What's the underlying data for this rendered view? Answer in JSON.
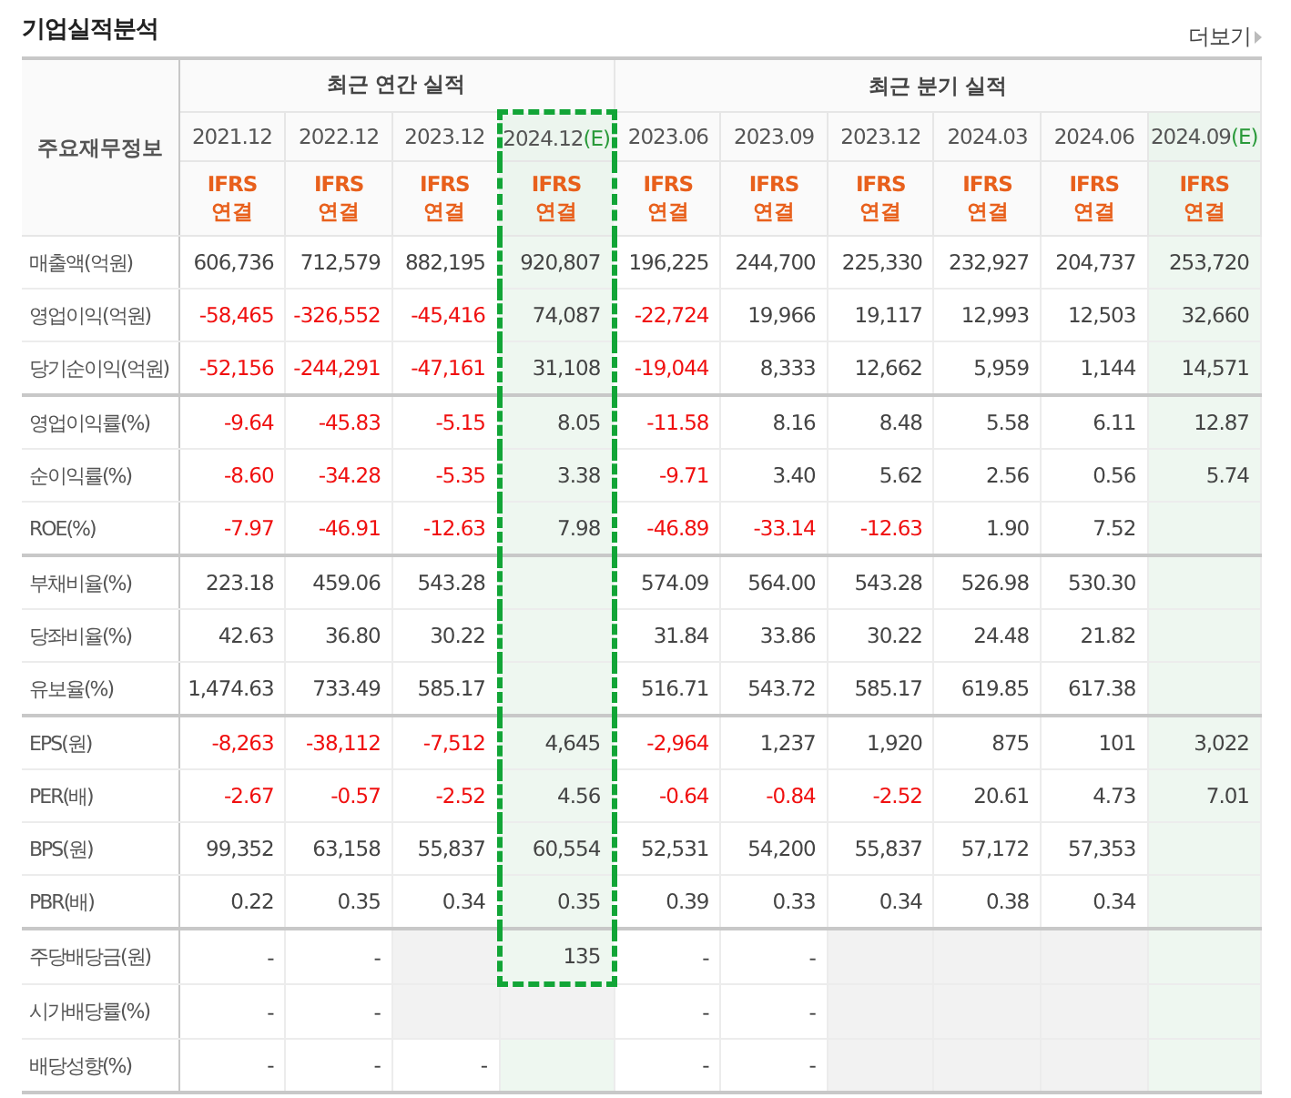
{
  "title": "기업실적분석",
  "more_link": "더보기",
  "table": {
    "corner": "주요재무정보",
    "groups": [
      {
        "label": "최근 연간 실적",
        "columns": [
          {
            "date": "2021.12",
            "basis": "IFRS",
            "scope": "연결",
            "estimate": false,
            "boxed": false
          },
          {
            "date": "2022.12",
            "basis": "IFRS",
            "scope": "연결",
            "estimate": false,
            "boxed": false
          },
          {
            "date": "2023.12",
            "basis": "IFRS",
            "scope": "연결",
            "estimate": false,
            "boxed": false
          },
          {
            "date": "2024.12",
            "suffix": "(E)",
            "basis": "IFRS",
            "scope": "연결",
            "estimate": true,
            "boxed": true
          }
        ]
      },
      {
        "label": "최근 분기 실적",
        "columns": [
          {
            "date": "2023.06",
            "basis": "IFRS",
            "scope": "연결",
            "estimate": false,
            "boxed": false
          },
          {
            "date": "2023.09",
            "basis": "IFRS",
            "scope": "연결",
            "estimate": false,
            "boxed": false
          },
          {
            "date": "2023.12",
            "basis": "IFRS",
            "scope": "연결",
            "estimate": false,
            "boxed": false
          },
          {
            "date": "2024.03",
            "basis": "IFRS",
            "scope": "연결",
            "estimate": false,
            "boxed": false
          },
          {
            "date": "2024.06",
            "basis": "IFRS",
            "scope": "연결",
            "estimate": false,
            "boxed": false
          },
          {
            "date": "2024.09",
            "suffix": "(E)",
            "basis": "IFRS",
            "scope": "연결",
            "estimate": true,
            "boxed": false
          }
        ]
      }
    ],
    "row_groups": [
      [
        {
          "label": "매출액(억원)",
          "boxed": true,
          "cells": [
            {
              "text": "606,736",
              "negative": false
            },
            {
              "text": "712,579",
              "negative": false
            },
            {
              "text": "882,195",
              "negative": false
            },
            {
              "text": "920,807",
              "negative": false
            },
            {
              "text": "196,225",
              "negative": false
            },
            {
              "text": "244,700",
              "negative": false
            },
            {
              "text": "225,330",
              "negative": false
            },
            {
              "text": "232,927",
              "negative": false
            },
            {
              "text": "204,737",
              "negative": false
            },
            {
              "text": "253,720",
              "negative": false
            }
          ]
        },
        {
          "label": "영업이익(억원)",
          "boxed": true,
          "cells": [
            {
              "text": "-58,465",
              "negative": true
            },
            {
              "text": "-326,552",
              "negative": true
            },
            {
              "text": "-45,416",
              "negative": true
            },
            {
              "text": "74,087",
              "negative": false
            },
            {
              "text": "-22,724",
              "negative": true
            },
            {
              "text": "19,966",
              "negative": false
            },
            {
              "text": "19,117",
              "negative": false
            },
            {
              "text": "12,993",
              "negative": false
            },
            {
              "text": "12,503",
              "negative": false
            },
            {
              "text": "32,660",
              "negative": false
            }
          ]
        },
        {
          "label": "당기순이익(억원)",
          "boxed": true,
          "cells": [
            {
              "text": "-52,156",
              "negative": true
            },
            {
              "text": "-244,291",
              "negative": true
            },
            {
              "text": "-47,161",
              "negative": true
            },
            {
              "text": "31,108",
              "negative": false
            },
            {
              "text": "-19,044",
              "negative": true
            },
            {
              "text": "8,333",
              "negative": false
            },
            {
              "text": "12,662",
              "negative": false
            },
            {
              "text": "5,959",
              "negative": false
            },
            {
              "text": "1,144",
              "negative": false
            },
            {
              "text": "14,571",
              "negative": false
            }
          ]
        }
      ],
      [
        {
          "label": "영업이익률(%)",
          "boxed": true,
          "cells": [
            {
              "text": "-9.64",
              "negative": true
            },
            {
              "text": "-45.83",
              "negative": true
            },
            {
              "text": "-5.15",
              "negative": true
            },
            {
              "text": "8.05",
              "negative": false
            },
            {
              "text": "-11.58",
              "negative": true
            },
            {
              "text": "8.16",
              "negative": false
            },
            {
              "text": "8.48",
              "negative": false
            },
            {
              "text": "5.58",
              "negative": false
            },
            {
              "text": "6.11",
              "negative": false
            },
            {
              "text": "12.87",
              "negative": false
            }
          ]
        },
        {
          "label": "순이익률(%)",
          "boxed": true,
          "cells": [
            {
              "text": "-8.60",
              "negative": true
            },
            {
              "text": "-34.28",
              "negative": true
            },
            {
              "text": "-5.35",
              "negative": true
            },
            {
              "text": "3.38",
              "negative": false
            },
            {
              "text": "-9.71",
              "negative": true
            },
            {
              "text": "3.40",
              "negative": false
            },
            {
              "text": "5.62",
              "negative": false
            },
            {
              "text": "2.56",
              "negative": false
            },
            {
              "text": "0.56",
              "negative": false
            },
            {
              "text": "5.74",
              "negative": false
            }
          ]
        },
        {
          "label": "ROE(%)",
          "boxed": true,
          "cells": [
            {
              "text": "-7.97",
              "negative": true
            },
            {
              "text": "-46.91",
              "negative": true
            },
            {
              "text": "-12.63",
              "negative": true
            },
            {
              "text": "7.98",
              "negative": false
            },
            {
              "text": "-46.89",
              "negative": true
            },
            {
              "text": "-33.14",
              "negative": true
            },
            {
              "text": "-12.63",
              "negative": true
            },
            {
              "text": "1.90",
              "negative": false
            },
            {
              "text": "7.52",
              "negative": false
            },
            null
          ]
        }
      ],
      [
        {
          "label": "부채비율(%)",
          "boxed": true,
          "cells": [
            {
              "text": "223.18",
              "negative": false
            },
            {
              "text": "459.06",
              "negative": false
            },
            {
              "text": "543.28",
              "negative": false
            },
            null,
            {
              "text": "574.09",
              "negative": false
            },
            {
              "text": "564.00",
              "negative": false
            },
            {
              "text": "543.28",
              "negative": false
            },
            {
              "text": "526.98",
              "negative": false
            },
            {
              "text": "530.30",
              "negative": false
            },
            null
          ]
        },
        {
          "label": "당좌비율(%)",
          "boxed": true,
          "cells": [
            {
              "text": "42.63",
              "negative": false
            },
            {
              "text": "36.80",
              "negative": false
            },
            {
              "text": "30.22",
              "negative": false
            },
            null,
            {
              "text": "31.84",
              "negative": false
            },
            {
              "text": "33.86",
              "negative": false
            },
            {
              "text": "30.22",
              "negative": false
            },
            {
              "text": "24.48",
              "negative": false
            },
            {
              "text": "21.82",
              "negative": false
            },
            null
          ]
        },
        {
          "label": "유보율(%)",
          "boxed": true,
          "cells": [
            {
              "text": "1,474.63",
              "negative": false
            },
            {
              "text": "733.49",
              "negative": false
            },
            {
              "text": "585.17",
              "negative": false
            },
            null,
            {
              "text": "516.71",
              "negative": false
            },
            {
              "text": "543.72",
              "negative": false
            },
            {
              "text": "585.17",
              "negative": false
            },
            {
              "text": "619.85",
              "negative": false
            },
            {
              "text": "617.38",
              "negative": false
            },
            null
          ]
        }
      ],
      [
        {
          "label": "EPS(원)",
          "boxed": true,
          "cells": [
            {
              "text": "-8,263",
              "negative": true
            },
            {
              "text": "-38,112",
              "negative": true
            },
            {
              "text": "-7,512",
              "negative": true
            },
            {
              "text": "4,645",
              "negative": false
            },
            {
              "text": "-2,964",
              "negative": true
            },
            {
              "text": "1,237",
              "negative": false
            },
            {
              "text": "1,920",
              "negative": false
            },
            {
              "text": "875",
              "negative": false
            },
            {
              "text": "101",
              "negative": false
            },
            {
              "text": "3,022",
              "negative": false
            }
          ]
        },
        {
          "label": "PER(배)",
          "boxed": true,
          "cells": [
            {
              "text": "-2.67",
              "negative": true
            },
            {
              "text": "-0.57",
              "negative": true
            },
            {
              "text": "-2.52",
              "negative": true
            },
            {
              "text": "4.56",
              "negative": false
            },
            {
              "text": "-0.64",
              "negative": true
            },
            {
              "text": "-0.84",
              "negative": true
            },
            {
              "text": "-2.52",
              "negative": true
            },
            {
              "text": "20.61",
              "negative": false
            },
            {
              "text": "4.73",
              "negative": false
            },
            {
              "text": "7.01",
              "negative": false
            }
          ]
        },
        {
          "label": "BPS(원)",
          "boxed": true,
          "cells": [
            {
              "text": "99,352",
              "negative": false
            },
            {
              "text": "63,158",
              "negative": false
            },
            {
              "text": "55,837",
              "negative": false
            },
            {
              "text": "60,554",
              "negative": false
            },
            {
              "text": "52,531",
              "negative": false
            },
            {
              "text": "54,200",
              "negative": false
            },
            {
              "text": "55,837",
              "negative": false
            },
            {
              "text": "57,172",
              "negative": false
            },
            {
              "text": "57,353",
              "negative": false
            },
            null
          ]
        },
        {
          "label": "PBR(배)",
          "boxed": true,
          "cells": [
            {
              "text": "0.22",
              "negative": false
            },
            {
              "text": "0.35",
              "negative": false
            },
            {
              "text": "0.34",
              "negative": false
            },
            {
              "text": "0.35",
              "negative": false
            },
            {
              "text": "0.39",
              "negative": false
            },
            {
              "text": "0.33",
              "negative": false
            },
            {
              "text": "0.34",
              "negative": false
            },
            {
              "text": "0.38",
              "negative": false
            },
            {
              "text": "0.34",
              "negative": false
            },
            null
          ]
        }
      ],
      [
        {
          "label": "주당배당금(원)",
          "boxed": true,
          "cells": [
            {
              "text": "-",
              "negative": false
            },
            {
              "text": "-",
              "negative": false
            },
            {
              "unavailable": true
            },
            {
              "text": "135",
              "negative": false
            },
            {
              "text": "-",
              "negative": false
            },
            {
              "text": "-",
              "negative": false
            },
            {
              "unavailable": true
            },
            {
              "unavailable": true
            },
            {
              "unavailable": true
            },
            null
          ]
        },
        {
          "label": "시가배당률(%)",
          "boxed": false,
          "cells": [
            {
              "text": "-",
              "negative": false
            },
            {
              "text": "-",
              "negative": false
            },
            {
              "unavailable": true
            },
            {
              "unavailable": true
            },
            {
              "text": "-",
              "negative": false
            },
            {
              "text": "-",
              "negative": false
            },
            {
              "unavailable": true
            },
            {
              "unavailable": true
            },
            {
              "unavailable": true
            },
            null
          ]
        },
        {
          "label": "배당성향(%)",
          "boxed": false,
          "cells": [
            {
              "text": "-",
              "negative": false
            },
            {
              "text": "-",
              "negative": false
            },
            {
              "text": "-",
              "negative": false
            },
            null,
            {
              "text": "-",
              "negative": false
            },
            {
              "text": "-",
              "negative": false
            },
            {
              "unavailable": true
            },
            {
              "unavailable": true
            },
            {
              "unavailable": true
            },
            null
          ]
        }
      ]
    ]
  }
}
